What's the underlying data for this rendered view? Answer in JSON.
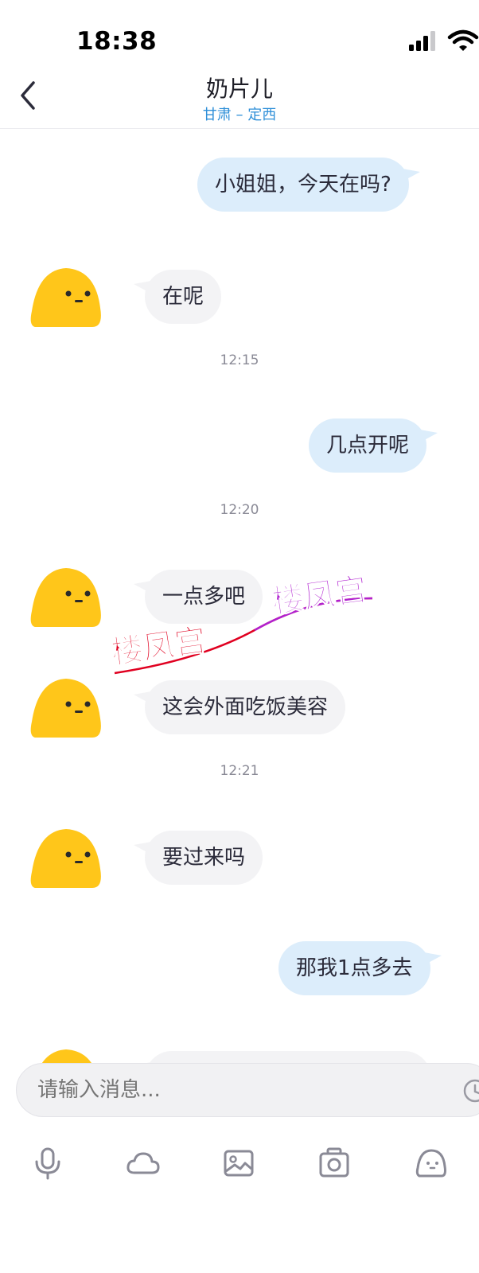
{
  "status_bar": {
    "time": "18:38"
  },
  "header": {
    "title": "奶片儿",
    "subtitle": "甘肃 – 定西"
  },
  "messages": [
    {
      "text": "小姐姐，今天在吗?"
    },
    {
      "text": "在呢"
    },
    {
      "time": "12:15"
    },
    {
      "text": "几点开呢"
    },
    {
      "time": "12:20"
    },
    {
      "text": "一点多吧"
    },
    {
      "text": "这会外面吃饭美容"
    },
    {
      "time": "12:21"
    },
    {
      "text": "要过来吗"
    },
    {
      "text": "那我1点多去"
    }
  ],
  "watermark": {
    "text_left": "楼凤宫",
    "text_right": "楼凤宫"
  },
  "composer": {
    "placeholder": "请输入消息..."
  },
  "toolbar_icons": [
    "mic-icon",
    "cloud-icon",
    "image-icon",
    "camera-icon",
    "emoji-icon"
  ],
  "colors": {
    "accent": "#2f8fd8",
    "outgoing_bubble": "#dcedfb",
    "incoming_bubble": "#f3f3f5",
    "avatar": "#ffc61a"
  }
}
